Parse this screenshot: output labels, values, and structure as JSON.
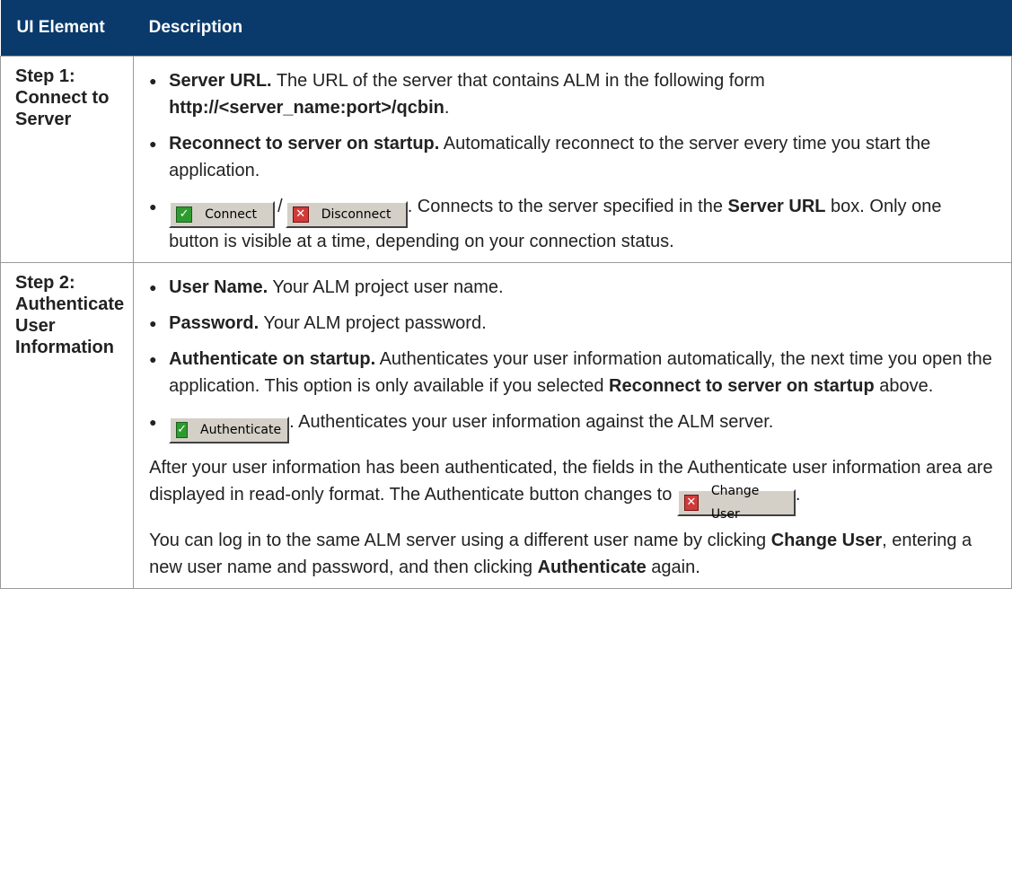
{
  "header": {
    "col1": "UI Element",
    "col2": "Description"
  },
  "row1": {
    "label": "Step 1: Connect to Server",
    "b1_term": "Server URL.",
    "b1_text": " The URL of the server that contains ALM in the following form ",
    "b1_code": "http://<server_name:port>/qcbin",
    "b1_end": ".",
    "b2_term": "Reconnect to server on startup.",
    "b2_text": " Automatically reconnect to the server every time you start the application.",
    "connect_label": "Connect",
    "slash": "/",
    "disconnect_label": "Disconnect",
    "b3_text1": ". Connects to the server specified in the ",
    "b3_term": "Server URL",
    "b3_text2": " box. Only one button is visible at a time, depending on your connection status."
  },
  "row2": {
    "label": "Step 2: Authenticate User Information",
    "b1_term": "User Name.",
    "b1_text": " Your ALM project user name.",
    "b2_term": "Password.",
    "b2_text": " Your ALM project password.",
    "b3_term": "Authenticate on startup.",
    "b3_text": " Authenticates your user information automatically, the next time you open the application. This option is only available if you selected ",
    "b3_term2": "Reconnect to server on startup",
    "b3_end": " above.",
    "authenticate_label": "Authenticate",
    "b4_text": ". Authenticates your user information against the ALM server.",
    "p1_text": "After your user information has been authenticated, the fields in the Authenticate user information area are displayed in read-only format. The Authenticate button changes to ",
    "change_user_label": "Change User",
    "p1_end": ".",
    "p2_text1": "You can log in to the same ALM server using a different user name by clicking ",
    "p2_term1": "Change User",
    "p2_text2": ", entering a new user name and password, and then clicking ",
    "p2_term2": "Authenticate",
    "p2_text3": " again."
  },
  "icons": {
    "check": "check-icon",
    "x": "x-icon"
  },
  "colors": {
    "header_bg": "#0a3a6b",
    "check_green": "#2e9b2e",
    "x_red": "#d23a3a",
    "button_face": "#d4d0c8"
  }
}
